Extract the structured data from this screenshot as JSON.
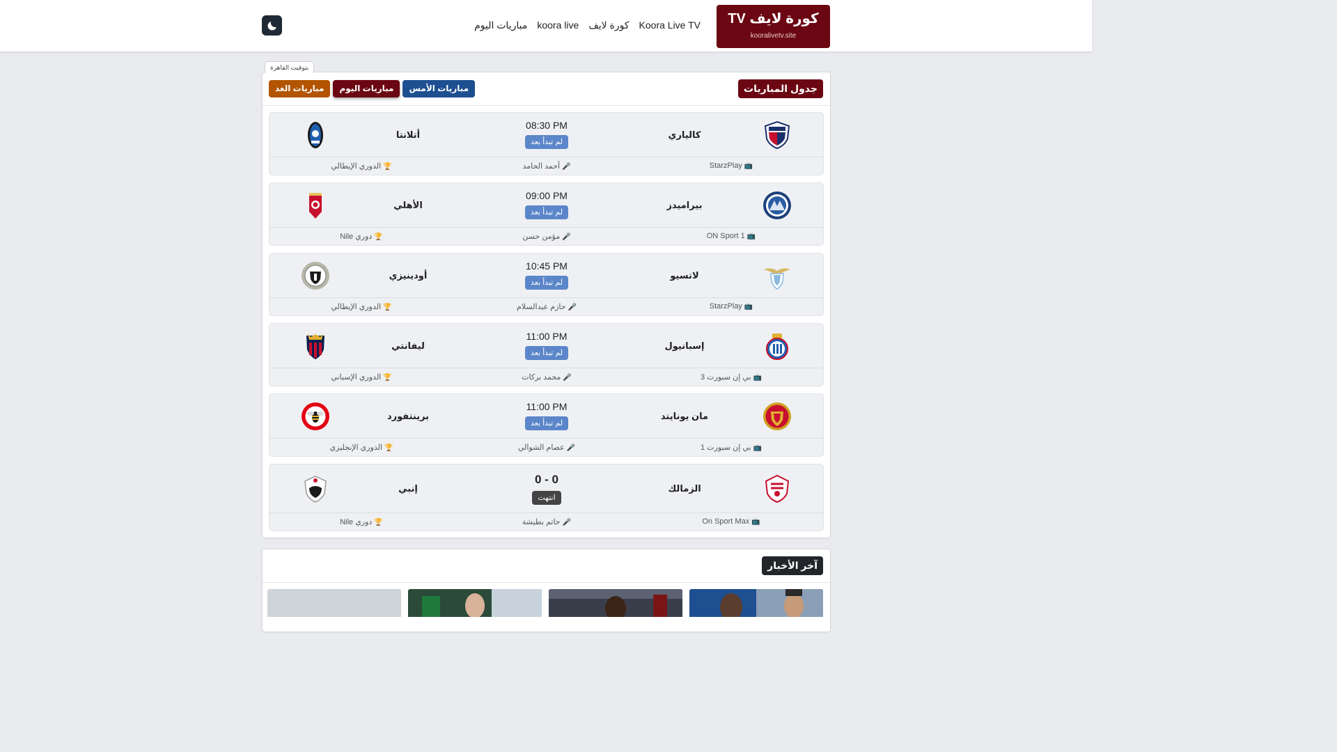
{
  "brand": {
    "title": "كورة لايف TV",
    "domain": "kooralivetv.site",
    "color": "#6b0712"
  },
  "nav": [
    "Koora Live TV",
    "كورة لايف",
    "koora live",
    "مباريات اليوم"
  ],
  "theme_toggle": {
    "icon": "moon-icon"
  },
  "matches_card": {
    "timezone_label": "بتوقيت القاهرة",
    "title": "جدول المباريات",
    "tabs": {
      "yesterday": "مباريات الأمس",
      "today": "مباريات اليوم",
      "tomorrow": "مباريات الغد"
    },
    "active_tab": "today"
  },
  "matches": [
    {
      "home": "كالياري",
      "away": "أتلانتا",
      "time": "08:30 PM",
      "status": "لم تبدأ بعد",
      "channel": "StarzPlay",
      "commentator": "أحمد الحامد",
      "league": "الدوري الإيطالي"
    },
    {
      "home": "بيراميدز",
      "away": "الأهلي",
      "time": "09:00 PM",
      "status": "لم تبدأ بعد",
      "channel": "ON Sport 1",
      "commentator": "مؤمن حسن",
      "league": "دوري Nile"
    },
    {
      "home": "لاتسيو",
      "away": "أودينيزي",
      "time": "10:45 PM",
      "status": "لم تبدأ بعد",
      "channel": "StarzPlay",
      "commentator": "حازم عبدالسلام",
      "league": "الدوري الإيطالي"
    },
    {
      "home": "إسبانيول",
      "away": "ليفانتي",
      "time": "11:00 PM",
      "status": "لم تبدأ بعد",
      "channel": "بي إن سبورت 3",
      "commentator": "محمد بركات",
      "league": "الدوري الإسباني"
    },
    {
      "home": "مان يونايتد",
      "away": "برينتفورد",
      "time": "11:00 PM",
      "status": "لم تبدأ بعد",
      "channel": "بي إن سبورت 1",
      "commentator": "عصام الشوالي",
      "league": "الدوري الإنجليزي"
    },
    {
      "home": "الزمالك",
      "away": "إنبي",
      "score": "0 - 0",
      "status": "انتهت",
      "channel": "On Sport Max",
      "commentator": "حاتم بطيشة",
      "league": "دوري Nile"
    }
  ],
  "news": {
    "title": "آخر الأخبار"
  },
  "icons": {
    "channel": "tv-icon",
    "commentator": "microphone-icon",
    "league": "trophy-icon"
  }
}
